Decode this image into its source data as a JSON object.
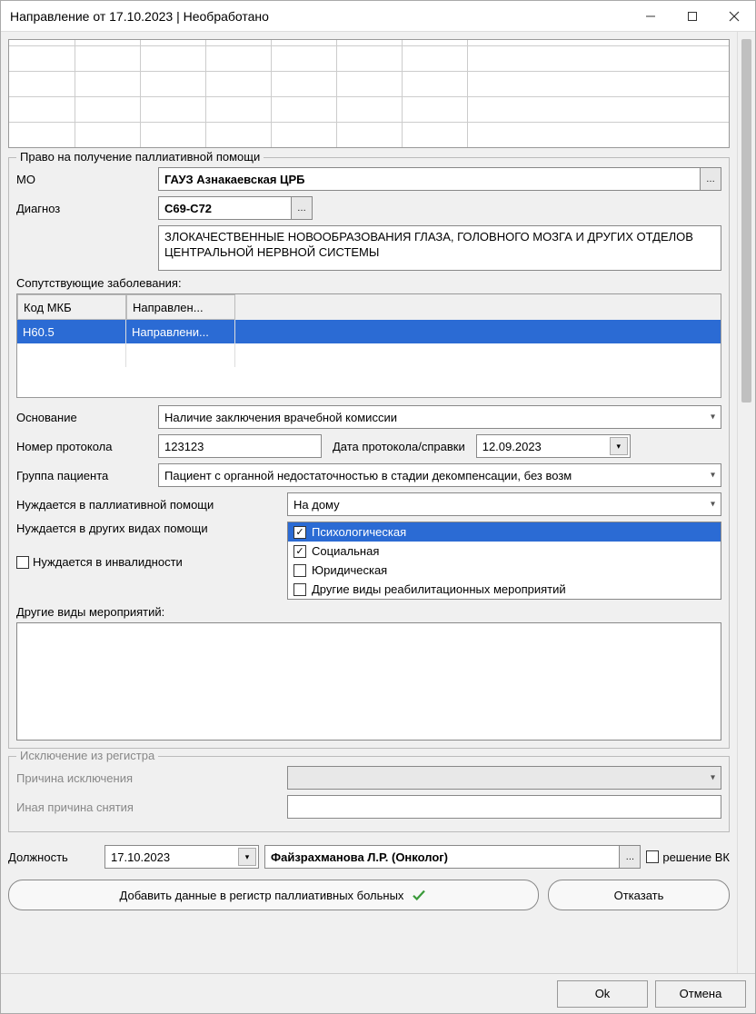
{
  "titlebar": {
    "title": "Направление от 17.10.2023 | Необработано"
  },
  "palliative": {
    "legend": "Право на получение паллиативной помощи",
    "mo_label": "МО",
    "mo_value": "ГАУЗ Азнакаевская ЦРБ",
    "diag_label": "Диагноз",
    "diag_code": "C69-C72",
    "diag_text": "ЗЛОКАЧЕСТВЕННЫЕ НОВООБРАЗОВАНИЯ ГЛАЗА, ГОЛОВНОГО МОЗГА И ДРУГИХ ОТДЕЛОВ ЦЕНТРАЛЬНОЙ НЕРВНОЙ СИСТЕМЫ",
    "comorbid_label": "Сопутствующие заболевания:",
    "comorbid_table": {
      "headers": [
        "Код МКБ",
        "Направлен..."
      ],
      "rows": [
        {
          "code": "H60.5",
          "ref": "Направлени..."
        }
      ]
    },
    "basis_label": "Основание",
    "basis_value": "Наличие заключения врачебной комиссии",
    "protocol_num_label": "Номер протокола",
    "protocol_num_value": "123123",
    "protocol_date_label": "Дата протокола/справки",
    "protocol_date_value": "12.09.2023",
    "group_label": "Группа пациента",
    "group_value": "Пациент с органной недостаточностью в стадии декомпенсации, без возм",
    "needs_pall_label": "Нуждается в паллиативной помощи",
    "needs_pall_value": "На дому",
    "needs_other_label": "Нуждается в других видах помощи",
    "needs_other_options": [
      {
        "label": "Психологическая",
        "checked": true,
        "selected": true
      },
      {
        "label": "Социальная",
        "checked": true,
        "selected": false
      },
      {
        "label": "Юридическая",
        "checked": false,
        "selected": false
      },
      {
        "label": "Другие виды реабилитационных мероприятий",
        "checked": false,
        "selected": false
      }
    ],
    "needs_invalid_label": "Нуждается в инвалидности",
    "needs_invalid_checked": false,
    "other_events_label": "Другие виды мероприятий:"
  },
  "exclusion": {
    "legend": "Исключение из регистра",
    "reason_label": "Причина исключения",
    "other_reason_label": "Иная причина снятия"
  },
  "bottom": {
    "position_label": "Должность",
    "position_date": "17.10.2023",
    "doctor_value": "Файзрахманова Л.Р. (Онколог)",
    "vk_label": "решение ВК",
    "add_btn": "Добавить данные в регистр паллиативных больных",
    "reject_btn": "Отказать"
  },
  "footer": {
    "ok": "Ok",
    "cancel": "Отмена"
  }
}
